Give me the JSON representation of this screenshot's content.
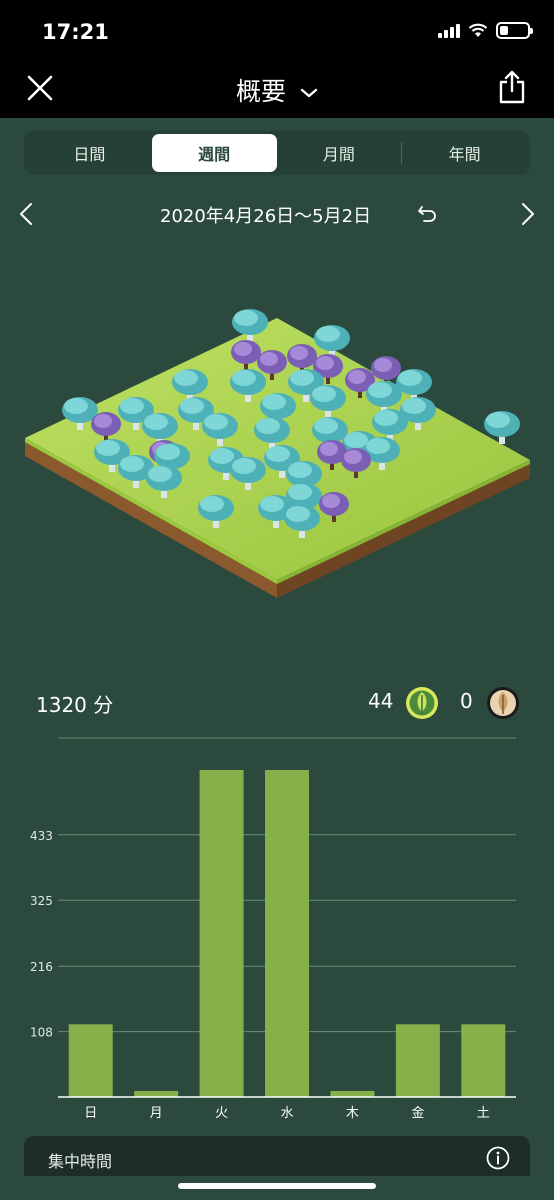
{
  "status_bar": {
    "time": "17:21"
  },
  "nav": {
    "title": "概要"
  },
  "tabs": [
    {
      "label": "日間",
      "active": false
    },
    {
      "label": "週間",
      "active": true
    },
    {
      "label": "月間",
      "active": false
    },
    {
      "label": "年間",
      "active": false
    }
  ],
  "date_range": "2020年4月26日～5月2日",
  "stats": {
    "total_time": "1320 分",
    "alive_trees": "44",
    "dead_trees": "0"
  },
  "chart_data": {
    "type": "bar",
    "categories": [
      "日",
      "月",
      "火",
      "水",
      "木",
      "金",
      "土"
    ],
    "values": [
      120,
      10,
      540,
      540,
      10,
      120,
      120
    ],
    "yticks": [
      "108",
      "216",
      "325",
      "433"
    ],
    "ytick_values": [
      108,
      216,
      325,
      433
    ],
    "ylim": [
      0,
      540
    ],
    "grid": true,
    "bar_color": "#86b14a"
  },
  "bottom_card": {
    "title": "集中時間"
  },
  "colors": {
    "background": "#2b4a3d",
    "accent": "#86b14a",
    "grass": "#a8d04a",
    "tree_teal": "#5ec3c7",
    "tree_purple": "#8a6fc4"
  }
}
